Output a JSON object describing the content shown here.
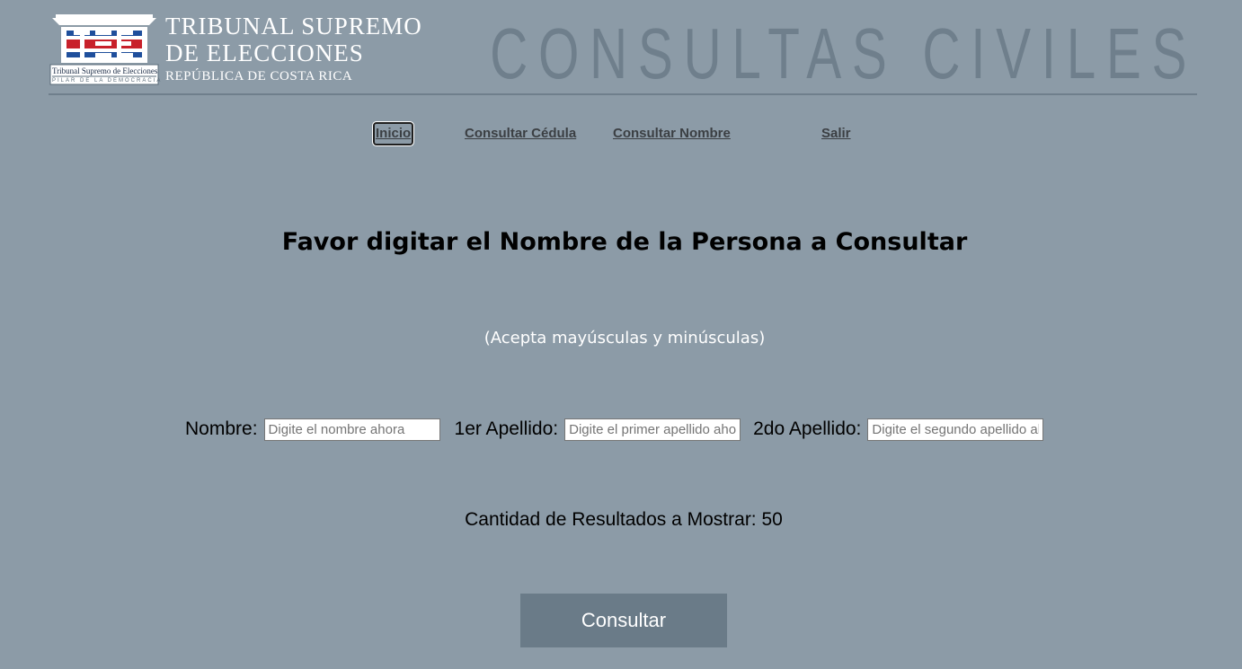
{
  "header": {
    "logo": {
      "name": "tse-logo",
      "caption": "Tribunal Supremo de Elecciones",
      "motto": "PILAR DE LA DEMOCRACIA"
    },
    "org_line1": "TRIBUNAL SUPREMO",
    "org_line2": "DE ELECCIONES",
    "org_line3": "REPÚBLICA DE COSTA RICA",
    "page_title": "CONSULTAS CIVILES",
    "colors": {
      "title": "#6f7f8c",
      "background": "#8c9ba7"
    }
  },
  "nav": {
    "items": [
      {
        "label": "Inicio",
        "active": true
      },
      {
        "label": "Consultar Cédula",
        "active": false
      },
      {
        "label": "Consultar Nombre",
        "active": false
      },
      {
        "label": "Salir",
        "active": false
      }
    ]
  },
  "main": {
    "heading": "Favor digitar el Nombre de la Persona a Consultar",
    "subheading": "(Acepta mayúsculas y minúsculas)",
    "fields": [
      {
        "label": "Nombre:",
        "placeholder": "Digite el nombre ahora",
        "value": ""
      },
      {
        "label": "1er Apellido:",
        "placeholder": "Digite el primer apellido ahora",
        "value": ""
      },
      {
        "label": "2do Apellido:",
        "placeholder": "Digite el segundo apellido ahora",
        "value": ""
      }
    ],
    "results_count_text": "Cantidad de Resultados a Mostrar: 50",
    "submit_label": "Consultar",
    "colors": {
      "button_bg": "#6a7b88",
      "button_text": "#ffffff"
    }
  }
}
